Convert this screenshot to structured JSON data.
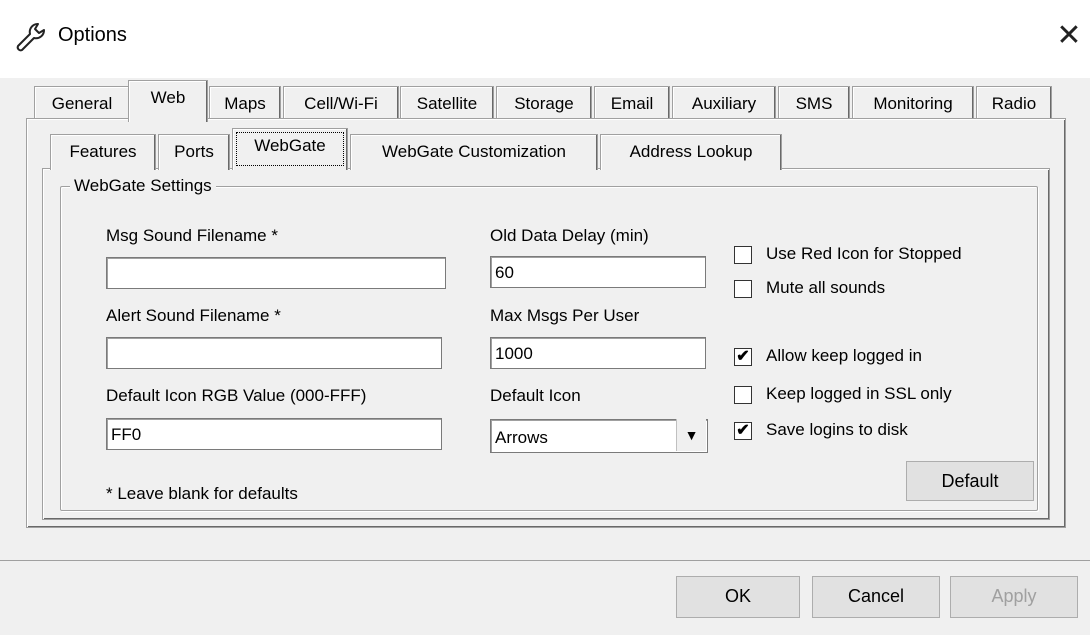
{
  "window": {
    "title": "Options",
    "close_glyph": "✕",
    "icon": "wrench-icon"
  },
  "outer_tabs": [
    "General",
    "Web",
    "Maps",
    "Cell/Wi-Fi",
    "Satellite",
    "Storage",
    "Email",
    "Auxiliary",
    "SMS",
    "Monitoring",
    "Radio"
  ],
  "outer_active": "Web",
  "inner_tabs": [
    "Features",
    "Ports",
    "WebGate",
    "WebGate Customization",
    "Address Lookup"
  ],
  "inner_active": "WebGate",
  "group": {
    "title": "WebGate Settings"
  },
  "fields": {
    "msg_sound": {
      "label": "Msg Sound Filename *",
      "value": ""
    },
    "alert_sound": {
      "label": "Alert Sound Filename *",
      "value": ""
    },
    "default_rgb": {
      "label": "Default Icon RGB Value (000-FFF)",
      "value": "FF0"
    },
    "old_data_delay": {
      "label": "Old Data Delay (min)",
      "value": "60"
    },
    "max_msgs": {
      "label": "Max Msgs Per User",
      "value": "1000"
    },
    "default_icon": {
      "label": "Default Icon",
      "value": "Arrows"
    }
  },
  "checkboxes": {
    "use_red_icon": {
      "label": "Use Red Icon for Stopped",
      "checked": false
    },
    "mute_sounds": {
      "label": "Mute all sounds",
      "checked": false
    },
    "allow_keep_logged": {
      "label": "Allow keep logged in",
      "checked": true
    },
    "keep_logged_ssl": {
      "label": "Keep logged in SSL only",
      "checked": false
    },
    "save_logins": {
      "label": "Save logins to disk",
      "checked": true
    }
  },
  "note": "* Leave blank for defaults",
  "buttons": {
    "default": "Default",
    "ok": "OK",
    "cancel": "Cancel",
    "apply": "Apply"
  },
  "check_glyph": "✔",
  "dropdown_glyph": "▼"
}
